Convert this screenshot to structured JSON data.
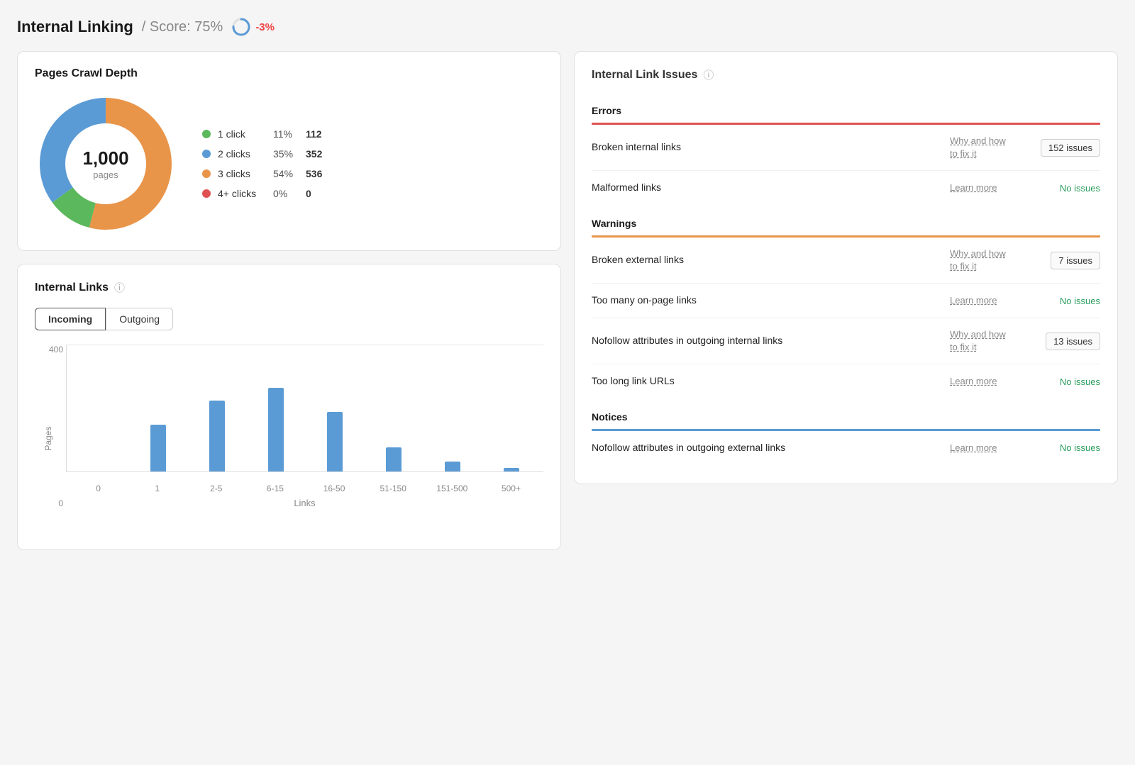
{
  "header": {
    "title": "Internal Linking",
    "score_label": "/ Score: 75%",
    "score_change": "-3%"
  },
  "crawl_depth": {
    "title": "Pages Crawl Depth",
    "total": "1,000",
    "total_label": "pages",
    "legend": [
      {
        "label": "1 click",
        "pct": "11%",
        "count": "112",
        "color": "#5cb85c"
      },
      {
        "label": "2 clicks",
        "pct": "35%",
        "count": "352",
        "color": "#5b9bd5"
      },
      {
        "label": "3 clicks",
        "pct": "54%",
        "count": "536",
        "color": "#e8954a"
      },
      {
        "label": "4+ clicks",
        "pct": "0%",
        "count": "0",
        "color": "#e05252"
      }
    ],
    "donut": {
      "segments": [
        {
          "pct": 11,
          "color": "#5cb85c"
        },
        {
          "pct": 35,
          "color": "#5b9bd5"
        },
        {
          "pct": 54,
          "color": "#e8954a"
        },
        {
          "pct": 0,
          "color": "#e05252"
        }
      ]
    }
  },
  "internal_links": {
    "title": "Internal Links",
    "tab_incoming": "Incoming",
    "tab_outgoing": "Outgoing",
    "y_axis_title": "Pages",
    "x_axis_title": "Links",
    "y_labels": [
      "400",
      "0"
    ],
    "bars": [
      {
        "label": "0",
        "height_pct": 0
      },
      {
        "label": "1",
        "height_pct": 42
      },
      {
        "label": "2-5",
        "height_pct": 62
      },
      {
        "label": "6-15",
        "height_pct": 72
      },
      {
        "label": "16-50",
        "height_pct": 52
      },
      {
        "label": "51-150",
        "height_pct": 20
      },
      {
        "label": "151-500",
        "height_pct": 8
      },
      {
        "label": "500+",
        "height_pct": 3
      }
    ]
  },
  "issues": {
    "title": "Internal Link Issues",
    "sections": [
      {
        "name": "Errors",
        "type": "error",
        "items": [
          {
            "label": "Broken internal links",
            "link_text": "Why and how to fix it",
            "badge": "152 issues",
            "badge_type": "count"
          },
          {
            "label": "Malformed links",
            "link_text": "Learn more",
            "badge": "No issues",
            "badge_type": "none"
          }
        ]
      },
      {
        "name": "Warnings",
        "type": "warning",
        "items": [
          {
            "label": "Broken external links",
            "link_text": "Why and how to fix it",
            "badge": "7 issues",
            "badge_type": "count"
          },
          {
            "label": "Too many on-page links",
            "link_text": "Learn more",
            "badge": "No issues",
            "badge_type": "none"
          },
          {
            "label": "Nofollow attributes in outgoing internal links",
            "link_text": "Why and how to fix it",
            "badge": "13 issues",
            "badge_type": "count"
          },
          {
            "label": "Too long link URLs",
            "link_text": "Learn more",
            "badge": "No issues",
            "badge_type": "none"
          }
        ]
      },
      {
        "name": "Notices",
        "type": "notice",
        "items": [
          {
            "label": "Nofollow attributes in outgoing external links",
            "link_text": "Learn more",
            "badge": "No issues",
            "badge_type": "none"
          }
        ]
      }
    ]
  }
}
